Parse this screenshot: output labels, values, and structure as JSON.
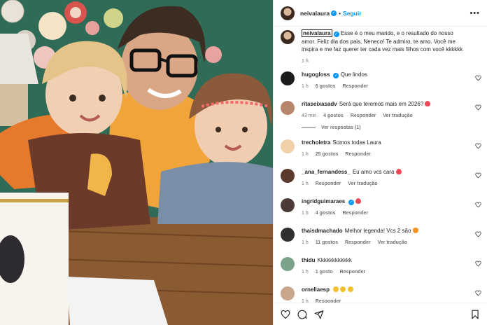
{
  "post": {
    "username": "neivalaura",
    "follow_label": "Seguir",
    "more_label": "•••"
  },
  "caption": {
    "username": "neivalaura",
    "text": "Esse é o meu marido, e o resultado do nosso amor. Feliz dia dos pais, Neneco! Te admiro, te amo. Você me inspira e me faz querer ter cada vez mais filhos com você kkkkkk",
    "time": "1 h"
  },
  "comments": [
    {
      "username": "hugogloss",
      "verified": true,
      "text": "Que lindos",
      "time": "1 h",
      "likes": "6 gostos",
      "reply": "Responder",
      "translate": "",
      "emoji": "",
      "avatar_color": "#1b1b1b"
    },
    {
      "username": "ritaseixasadv",
      "verified": false,
      "text": "Será que teremos mais em 2026?",
      "time": "43 min",
      "likes": "4 gostos",
      "reply": "Responder",
      "translate": "Ver tradução",
      "emoji": "red",
      "avatar_color": "#b5866a"
    },
    {
      "username": "trecholetra",
      "verified": false,
      "text": "Somos todas Laura",
      "time": "1 h",
      "likes": "25 gostos",
      "reply": "Responder",
      "translate": "",
      "emoji": "",
      "avatar_color": "#f1d2a8"
    },
    {
      "username": "_ana_fernandess_",
      "verified": false,
      "text": "Eu amo vcs cara",
      "time": "1 h",
      "likes": "",
      "reply": "Responder",
      "translate": "Ver tradução",
      "emoji": "red",
      "avatar_color": "#5a3a2c"
    },
    {
      "username": "ingridguimaraes",
      "verified": true,
      "text": "",
      "time": "1 h",
      "likes": "4 gostos",
      "reply": "Responder",
      "translate": "",
      "emoji": "red",
      "avatar_color": "#4a3b36"
    },
    {
      "username": "thaisdmachado",
      "verified": false,
      "text": "Melhor legenda! Vcs 2 são",
      "time": "1 h",
      "likes": "11 gostos",
      "reply": "Responder",
      "translate": "Ver tradução",
      "emoji": "orange",
      "avatar_color": "#2f2f2f"
    },
    {
      "username": "thidu",
      "verified": false,
      "text": "Kkkkkkkkkkkk",
      "time": "1 h",
      "likes": "1 gosto",
      "reply": "Responder",
      "translate": "",
      "emoji": "",
      "avatar_color": "#7aa38a"
    },
    {
      "username": "ornellaesp",
      "verified": false,
      "text": "",
      "time": "1 h",
      "likes": "",
      "reply": "Responder",
      "translate": "",
      "emoji": "clap",
      "avatar_color": "#c9a58a"
    }
  ],
  "view_replies": "Ver respostas (1)",
  "icons": {
    "like": "heart-icon",
    "comment": "comment-icon",
    "share": "send-icon",
    "save": "bookmark-icon"
  },
  "colors": {
    "accent": "#0095f6",
    "muted": "#737373",
    "text": "#262626"
  }
}
